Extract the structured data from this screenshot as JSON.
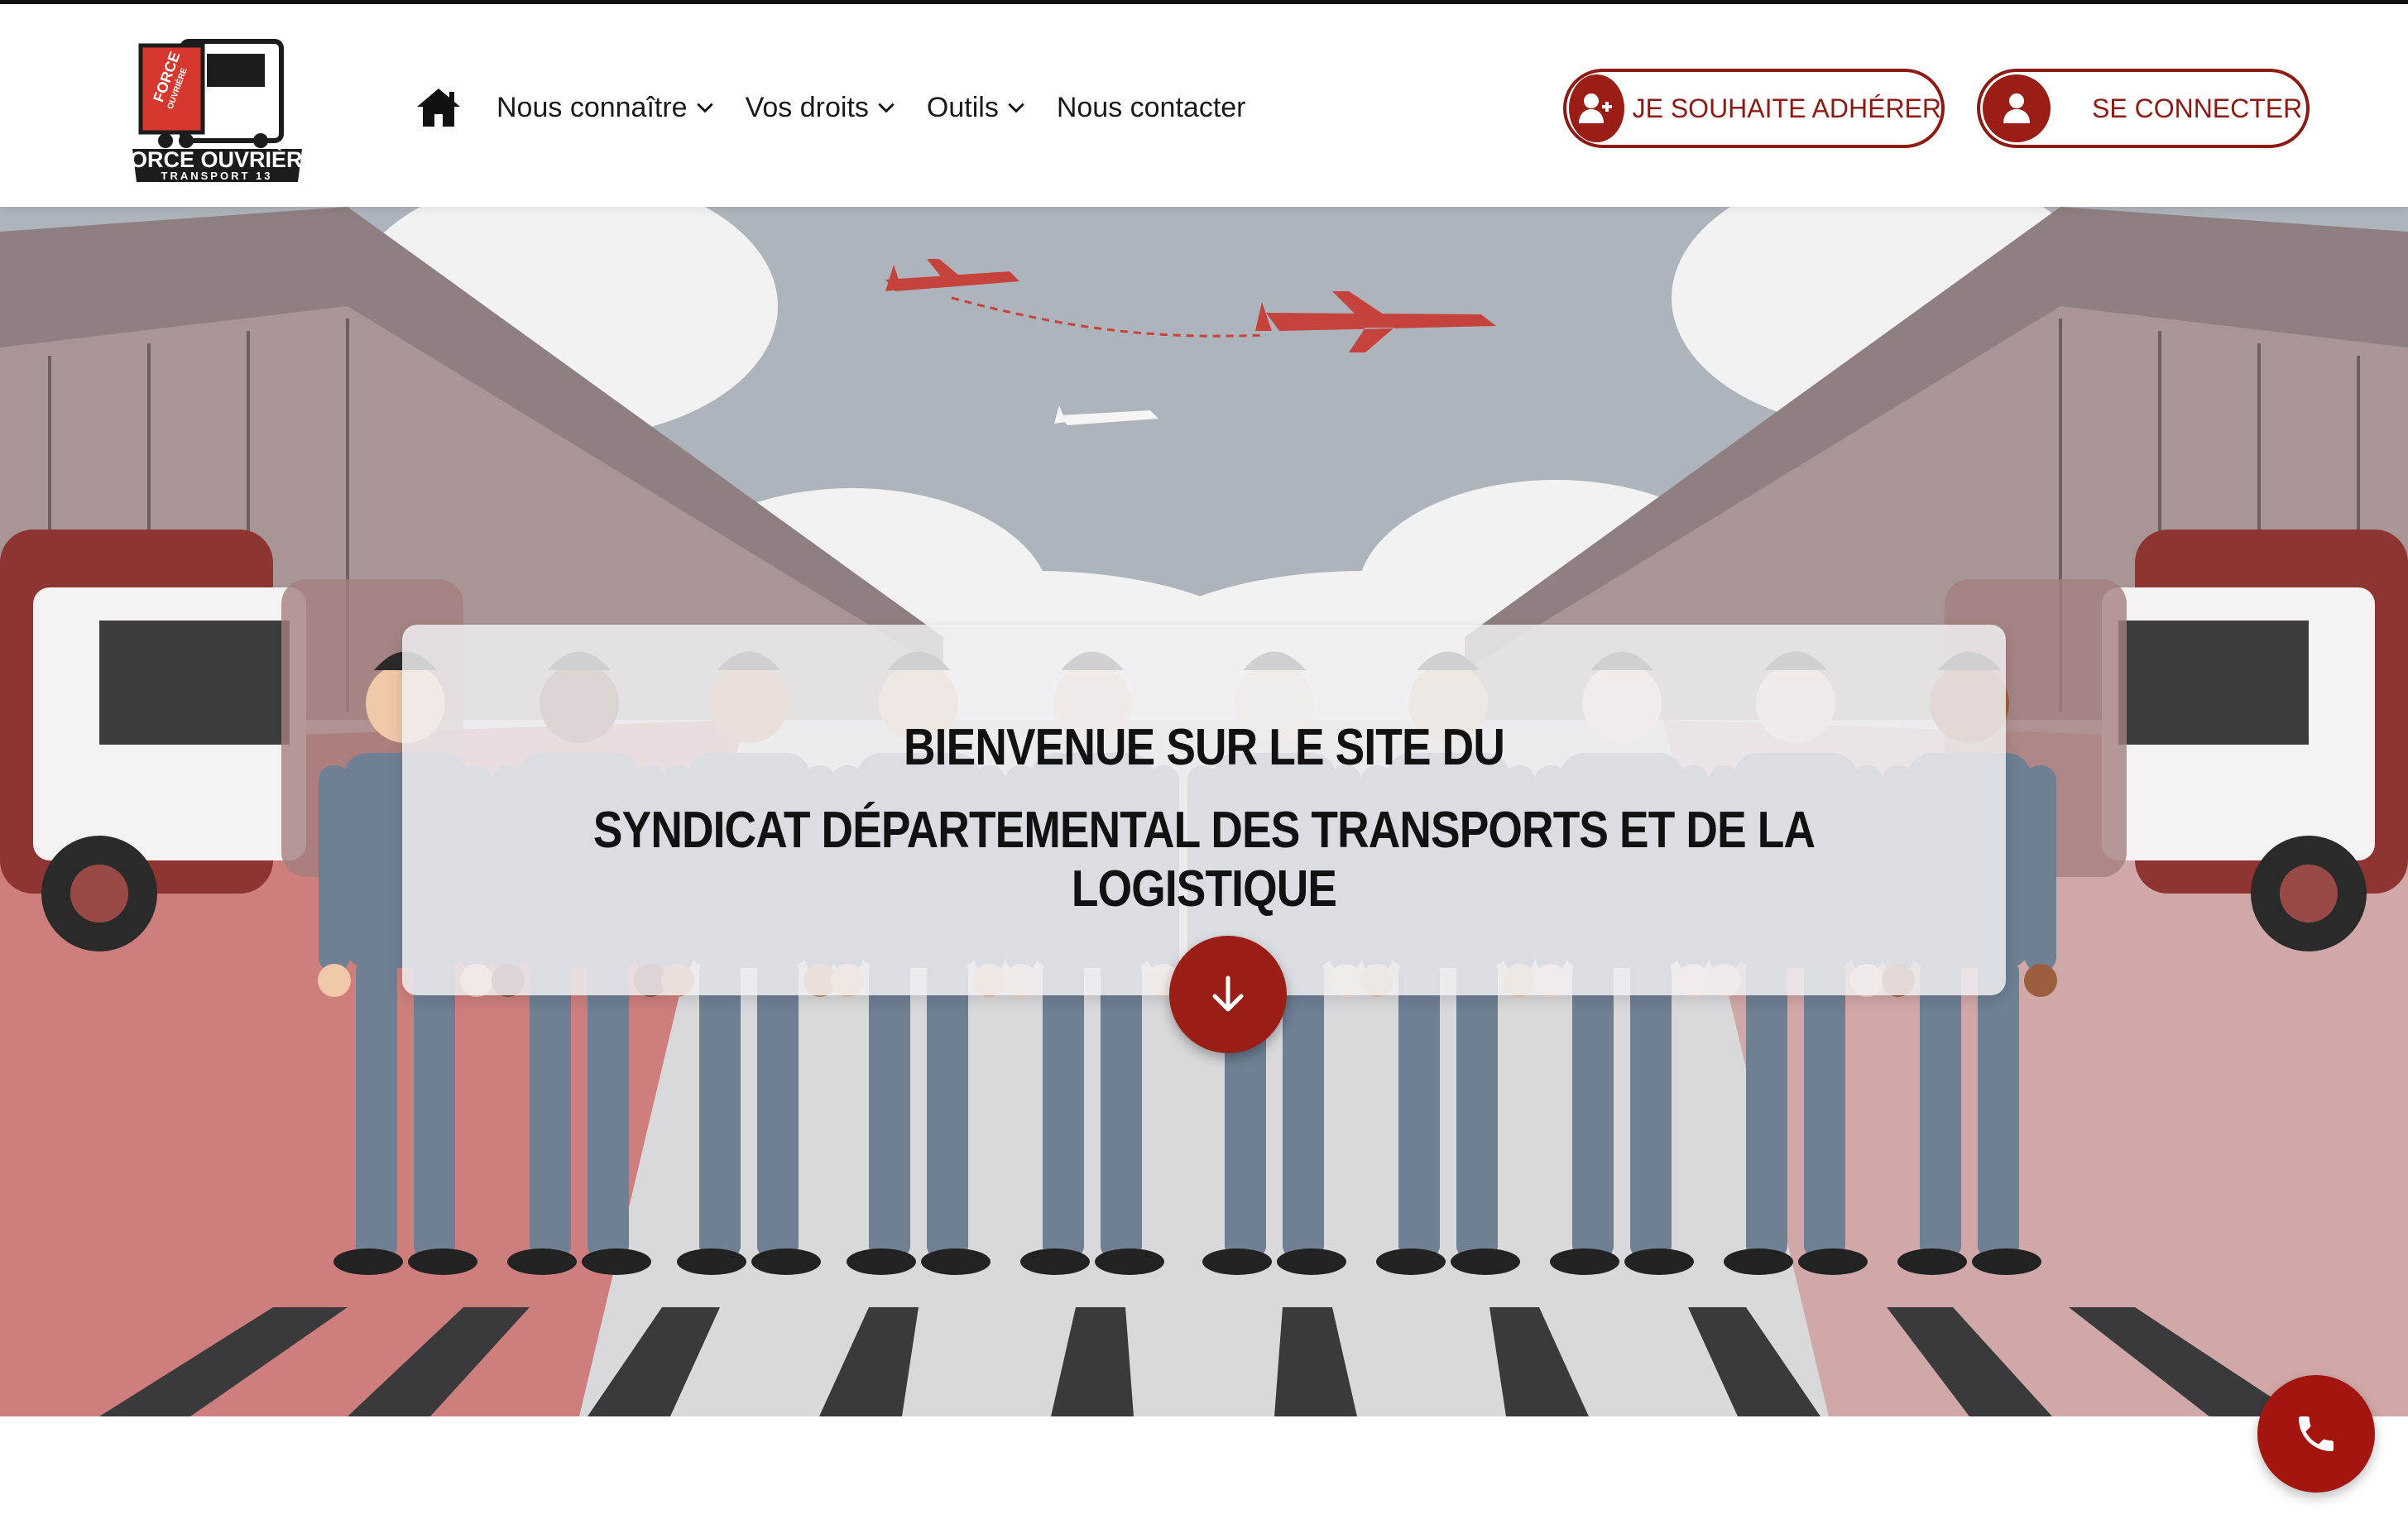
{
  "header": {
    "logo": {
      "line1": "FORCE",
      "line2": "OUVRIÈRE",
      "brand": "FORCE OUVRIÈRE",
      "sub": "TRANSPORT 13"
    },
    "nav": [
      {
        "label": "Nous connaître",
        "has_dropdown": true
      },
      {
        "label": "Vos droits",
        "has_dropdown": true
      },
      {
        "label": "Outils",
        "has_dropdown": true
      },
      {
        "label": "Nous contacter",
        "has_dropdown": false
      }
    ],
    "join_label": "JE SOUHAITE ADHÉRER",
    "login_label": "SE CONNECTER"
  },
  "hero": {
    "title_line1": "BIENVENUE SUR LE SITE DU",
    "title_line2": "SYNDICAT DÉPARTEMENTAL DES TRANSPORTS ET DE LA LOGISTIQUE"
  },
  "colors": {
    "accent": "#9a1e16",
    "nav_text": "#1a1a1a",
    "worker_uniform": "#6f7f94",
    "sky": "#aeb4bb"
  }
}
